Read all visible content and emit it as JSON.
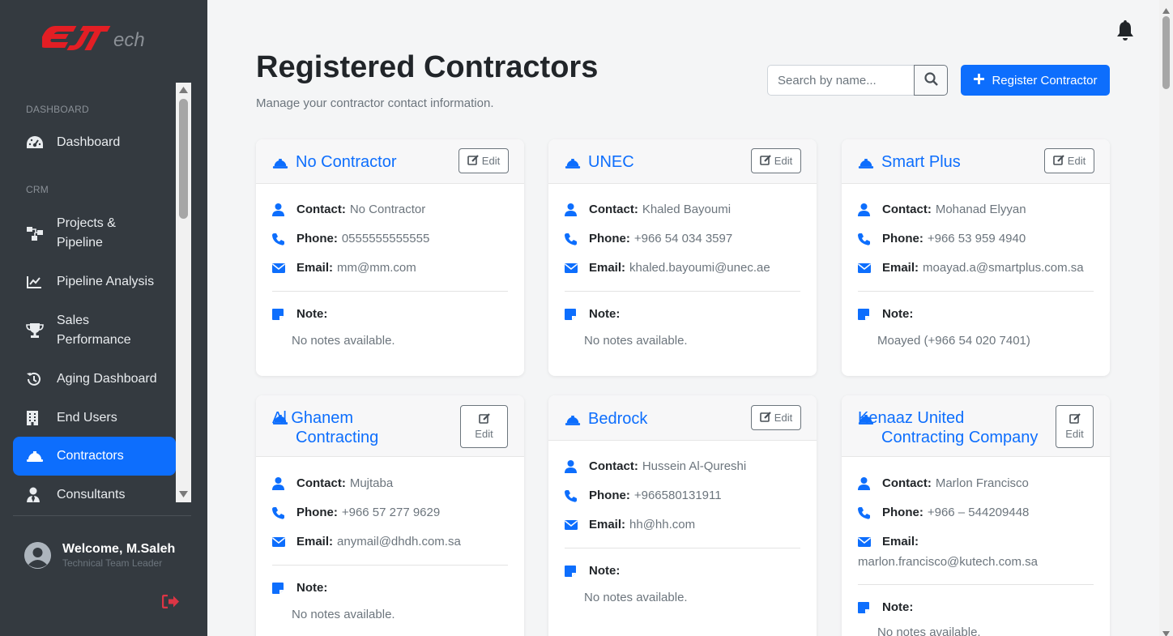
{
  "app": {
    "brand": "EJTech"
  },
  "sidebar": {
    "section_dashboard": "DASHBOARD",
    "section_crm": "CRM",
    "items": [
      {
        "label": "Dashboard",
        "icon": "gauge-icon"
      },
      {
        "label": "Projects & Pipeline",
        "icon": "sitemap-icon"
      },
      {
        "label": "Pipeline Analysis",
        "icon": "chart-line-icon"
      },
      {
        "label": "Sales Performance",
        "icon": "trophy-icon"
      },
      {
        "label": "Aging Dashboard",
        "icon": "history-icon"
      },
      {
        "label": "End Users",
        "icon": "building-icon"
      },
      {
        "label": "Contractors",
        "icon": "hard-hat-icon",
        "active": true
      },
      {
        "label": "Consultants",
        "icon": "user-tie-icon"
      }
    ],
    "user": {
      "welcome": "Welcome, M.Saleh",
      "role": "Technical Team Leader"
    }
  },
  "header": {
    "title": "Registered Contractors",
    "subtitle": "Manage your contractor contact information.",
    "search_placeholder": "Search by name...",
    "register_label": "Register Contractor"
  },
  "labels": {
    "contact": "Contact:",
    "phone": "Phone:",
    "email": "Email:",
    "note": "Note:",
    "edit": "Edit"
  },
  "contractors": [
    {
      "name": "No Contractor",
      "contact": "No Contractor",
      "phone": "0555555555555",
      "email": "mm@mm.com",
      "note": "No notes available."
    },
    {
      "name": "UNEC",
      "contact": "Khaled Bayoumi",
      "phone": "+966 54 034 3597",
      "email": "khaled.bayoumi@unec.ae",
      "note": "No notes available."
    },
    {
      "name": "Smart Plus",
      "contact": "Mohanad Elyyan",
      "phone": "+966 53 959 4940",
      "email": "moayad.a@smartplus.com.sa",
      "note": "Moayed (+966 54 020 7401)"
    },
    {
      "name": "Al Ghanem Contracting",
      "contact": "Mujtaba",
      "phone": "+966 57 277 9629",
      "email": "anymail@dhdh.com.sa",
      "note": "No notes available."
    },
    {
      "name": "Bedrock",
      "contact": "Hussein Al-Qureshi",
      "phone": "+966580131911",
      "email": "hh@hh.com",
      "note": "No notes available."
    },
    {
      "name": "Kenaaz United Contracting Company",
      "contact": "Marlon Francisco",
      "phone": "+966 – 544209448",
      "email": "marlon.francisco@kutech.com.sa",
      "note": "No notes available."
    }
  ],
  "colors": {
    "primary": "#0d6efd",
    "sidebar_bg": "#343a40",
    "logout": "#dc3545"
  }
}
